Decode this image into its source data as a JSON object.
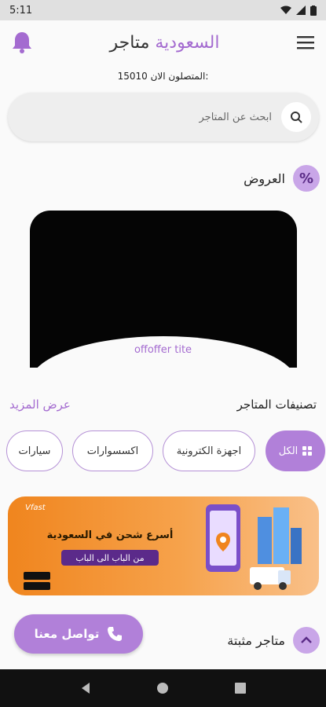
{
  "status": {
    "time": "5:11"
  },
  "header": {
    "title_part1": "متاجر",
    "title_part2": "السعودية"
  },
  "online": {
    "label": "المتصلون الان:",
    "count": "15010"
  },
  "search": {
    "placeholder": "ابحث عن المتاجر"
  },
  "offers": {
    "title": "العروض",
    "caption": "offoffer tite"
  },
  "categories": {
    "title": "تصنيفات المتاجر",
    "see_more": "عرض المزيد",
    "items": [
      {
        "label": "الكل",
        "active": true
      },
      {
        "label": "اجهزة الكترونية",
        "active": false
      },
      {
        "label": "اكسسوارات",
        "active": false
      },
      {
        "label": "سيارات",
        "active": false
      }
    ]
  },
  "banner": {
    "headline": "أسرع شحن في السعودية",
    "tag": "من الباب الى الباب",
    "logo": "Vfast"
  },
  "pinned": {
    "title": "متاجر مثبتة"
  },
  "contact": {
    "label": "تواصل معنا"
  },
  "colors": {
    "accent": "#a46bd0",
    "chip_active": "#b180d9",
    "banner_orange": "#f0851e"
  }
}
